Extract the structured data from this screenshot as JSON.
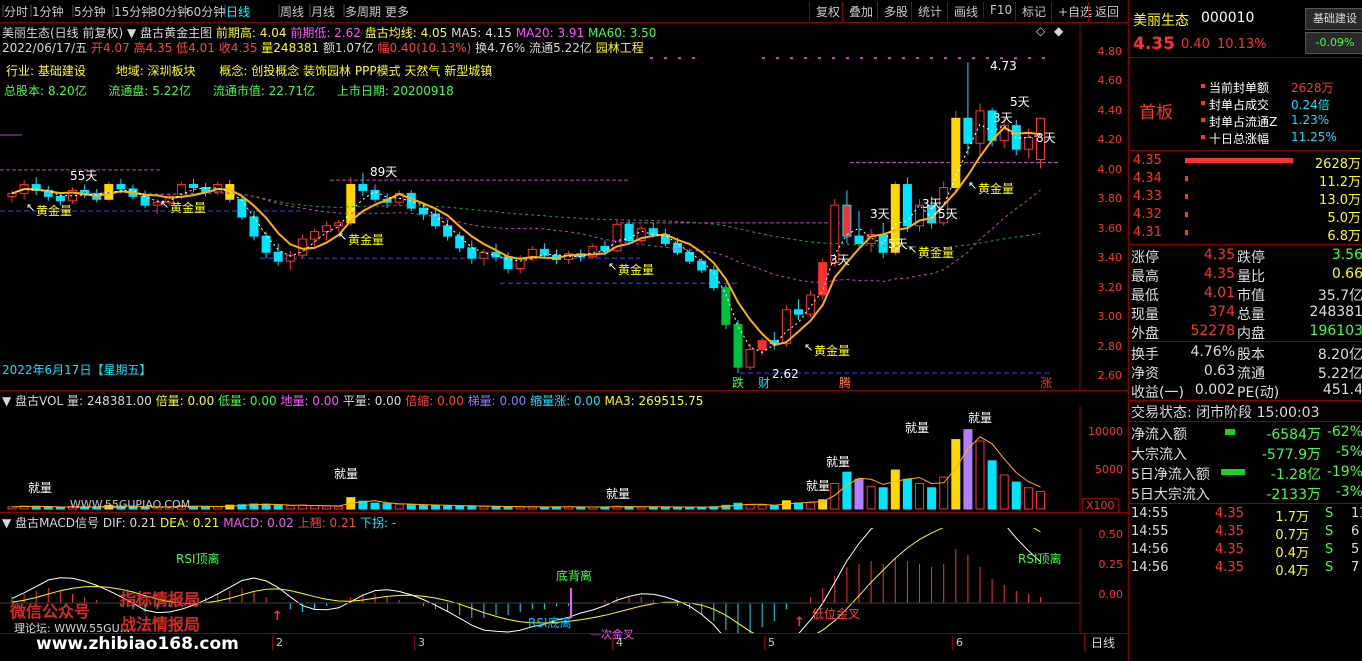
{
  "toolbar": {
    "periods": [
      "分时",
      "1分钟",
      "5分钟",
      "15分钟",
      "30分钟",
      "60分钟",
      "日线",
      "周线",
      "月线",
      "多周期",
      "更多"
    ],
    "active_period": "日线",
    "right_buttons": [
      "复权",
      "叠加",
      "多股",
      "统计",
      "画线",
      "F10",
      "标记",
      "+自选",
      "返回"
    ]
  },
  "header": {
    "line1": {
      "name": "美丽生态(日线 前复权)",
      "indicator": "盘古黄金主图",
      "prev_high_label": "前期高: 4.04",
      "prev_low_label": "前期低: 2.62",
      "pangu_ma_label": "盘古均线: 4.05",
      "ma5": "MA5: 4.15",
      "ma20": "MA20: 3.91",
      "ma60": "MA60: 3.50"
    },
    "line2": {
      "date": "2022/06/17/五",
      "open": "开4.07",
      "high": "高4.35",
      "low": "低4.01",
      "close": "收4.35",
      "volume": "量248381",
      "amount": "额1.07亿",
      "change": "幅0.40(10.13%)",
      "turnover": "换4.76%",
      "float_cap": "流通5.22亿",
      "theme": "园林工程"
    },
    "info1": {
      "industry": "行业: 基础建设",
      "region": "地域: 深圳板块",
      "concept": "概念: 创投概念 装饰园林 PPP模式 天然气 新型城镇"
    },
    "info2": {
      "total_shares": "总股本: 8.20亿",
      "float_shares": "流通盘: 5.22亿",
      "float_mv": "流通市值: 22.71亿",
      "list_date": "上市日期: 20200918"
    }
  },
  "main_chart": {
    "y_ticks": [
      "4.80",
      "4.60",
      "4.40",
      "4.20",
      "4.00",
      "3.80",
      "3.60",
      "3.40",
      "3.20",
      "3.00",
      "2.80",
      "2.60"
    ],
    "annotations": {
      "high": "4.73",
      "low": "2.62",
      "d55": "55天",
      "d89": "89天",
      "d5a": "5天",
      "d3a": "3天",
      "d8": "8天",
      "golden": "黄金量",
      "date_overlay": "2022年6月17日【星期五】",
      "tag_die": "跌",
      "tag_cai": "财",
      "tag_teng": "腾",
      "tag_zhang": "涨"
    },
    "candles": [
      [
        3.82,
        3.86,
        3.78,
        3.84
      ],
      [
        3.84,
        3.93,
        3.8,
        3.9
      ],
      [
        3.9,
        3.95,
        3.83,
        3.86
      ],
      [
        3.86,
        3.89,
        3.79,
        3.82
      ],
      [
        3.82,
        3.85,
        3.76,
        3.79
      ],
      [
        3.79,
        3.88,
        3.77,
        3.86
      ],
      [
        3.86,
        3.9,
        3.81,
        3.84
      ],
      [
        3.84,
        3.87,
        3.78,
        3.8
      ],
      [
        3.8,
        3.92,
        3.79,
        3.9
      ],
      [
        3.9,
        3.94,
        3.84,
        3.87
      ],
      [
        3.87,
        3.9,
        3.8,
        3.82
      ],
      [
        3.82,
        3.86,
        3.74,
        3.76
      ],
      [
        3.76,
        3.8,
        3.7,
        3.78
      ],
      [
        3.78,
        3.84,
        3.76,
        3.82
      ],
      [
        3.82,
        3.92,
        3.8,
        3.9
      ],
      [
        3.9,
        3.94,
        3.85,
        3.88
      ],
      [
        3.88,
        3.91,
        3.82,
        3.85
      ],
      [
        3.85,
        3.92,
        3.83,
        3.9
      ],
      [
        3.9,
        3.93,
        3.78,
        3.8
      ],
      [
        3.8,
        3.82,
        3.66,
        3.68
      ],
      [
        3.68,
        3.72,
        3.52,
        3.55
      ],
      [
        3.55,
        3.58,
        3.4,
        3.44
      ],
      [
        3.44,
        3.5,
        3.35,
        3.38
      ],
      [
        3.38,
        3.45,
        3.32,
        3.42
      ],
      [
        3.42,
        3.56,
        3.4,
        3.53
      ],
      [
        3.53,
        3.6,
        3.48,
        3.58
      ],
      [
        3.58,
        3.65,
        3.52,
        3.62
      ],
      [
        3.62,
        3.66,
        3.58,
        3.64
      ],
      [
        3.64,
        3.95,
        3.62,
        3.9
      ],
      [
        3.9,
        3.98,
        3.82,
        3.86
      ],
      [
        3.86,
        3.9,
        3.78,
        3.8
      ],
      [
        3.8,
        3.84,
        3.74,
        3.78
      ],
      [
        3.78,
        3.86,
        3.76,
        3.84
      ],
      [
        3.84,
        3.86,
        3.72,
        3.74
      ],
      [
        3.74,
        3.78,
        3.66,
        3.7
      ],
      [
        3.7,
        3.74,
        3.6,
        3.62
      ],
      [
        3.62,
        3.66,
        3.52,
        3.55
      ],
      [
        3.55,
        3.58,
        3.44,
        3.47
      ],
      [
        3.47,
        3.52,
        3.36,
        3.4
      ],
      [
        3.4,
        3.46,
        3.35,
        3.44
      ],
      [
        3.44,
        3.5,
        3.38,
        3.41
      ],
      [
        3.41,
        3.44,
        3.3,
        3.33
      ],
      [
        3.33,
        3.42,
        3.3,
        3.4
      ],
      [
        3.4,
        3.48,
        3.38,
        3.46
      ],
      [
        3.46,
        3.5,
        3.4,
        3.42
      ],
      [
        3.42,
        3.46,
        3.36,
        3.39
      ],
      [
        3.39,
        3.45,
        3.36,
        3.43
      ],
      [
        3.43,
        3.46,
        3.38,
        3.41
      ],
      [
        3.41,
        3.5,
        3.4,
        3.48
      ],
      [
        3.48,
        3.52,
        3.42,
        3.45
      ],
      [
        3.45,
        3.66,
        3.44,
        3.63
      ],
      [
        3.63,
        3.66,
        3.5,
        3.52
      ],
      [
        3.52,
        3.62,
        3.5,
        3.6
      ],
      [
        3.6,
        3.64,
        3.54,
        3.56
      ],
      [
        3.56,
        3.6,
        3.48,
        3.5
      ],
      [
        3.5,
        3.54,
        3.42,
        3.44
      ],
      [
        3.44,
        3.46,
        3.36,
        3.38
      ],
      [
        3.38,
        3.4,
        3.3,
        3.32
      ],
      [
        3.32,
        3.35,
        3.18,
        3.2
      ],
      [
        3.2,
        3.22,
        2.92,
        2.95
      ],
      [
        2.95,
        2.98,
        2.62,
        2.66
      ],
      [
        2.66,
        2.82,
        2.64,
        2.78
      ],
      [
        2.78,
        2.86,
        2.74,
        2.84
      ],
      [
        2.84,
        2.9,
        2.78,
        2.82
      ],
      [
        2.82,
        3.08,
        2.8,
        3.05
      ],
      [
        3.05,
        3.12,
        2.98,
        3.02
      ],
      [
        3.02,
        3.18,
        3.0,
        3.15
      ],
      [
        3.15,
        3.4,
        3.12,
        3.37
      ],
      [
        3.37,
        3.8,
        3.34,
        3.76
      ],
      [
        3.76,
        3.86,
        3.5,
        3.55
      ],
      [
        3.55,
        3.72,
        3.48,
        3.5
      ],
      [
        3.5,
        3.6,
        3.44,
        3.56
      ],
      [
        3.56,
        3.64,
        3.4,
        3.44
      ],
      [
        3.44,
        3.92,
        3.42,
        3.9
      ],
      [
        3.9,
        3.95,
        3.58,
        3.62
      ],
      [
        3.62,
        3.8,
        3.58,
        3.76
      ],
      [
        3.76,
        3.82,
        3.6,
        3.64
      ],
      [
        3.64,
        3.92,
        3.62,
        3.88
      ],
      [
        3.88,
        4.4,
        3.86,
        4.35
      ],
      [
        4.35,
        4.73,
        4.1,
        4.18
      ],
      [
        4.18,
        4.45,
        4.1,
        4.4
      ],
      [
        4.4,
        4.42,
        4.16,
        4.2
      ],
      [
        4.2,
        4.36,
        4.15,
        4.3
      ],
      [
        4.3,
        4.34,
        4.1,
        4.14
      ],
      [
        4.14,
        4.28,
        4.08,
        4.22
      ],
      [
        4.07,
        4.35,
        4.01,
        4.35
      ]
    ]
  },
  "vol_panel": {
    "title": "盘古VOL",
    "vol": "量: 248381.00",
    "bei": "倍量: 0.00",
    "di": "低量: 0.00",
    "diliang": "地量: 0.00",
    "ping": "平量: 0.00",
    "beisuo": "倍缩: 0.00",
    "tiliang": "梯量: 0.00",
    "suozhang": "缩量涨: 0.00",
    "ma3": "MA3: 269515.75",
    "y_ticks": [
      "10000",
      "5000"
    ],
    "unit": "X100",
    "jiuliang": "就量",
    "website": "WWW.55GUPIAO.COM",
    "volumes": [
      300,
      420,
      380,
      260,
      240,
      360,
      300,
      280,
      520,
      400,
      320,
      310,
      260,
      300,
      480,
      380,
      300,
      360,
      540,
      600,
      700,
      680,
      520,
      460,
      560,
      480,
      420,
      380,
      1600,
      1100,
      820,
      760,
      680,
      620,
      560,
      520,
      480,
      440,
      420,
      380,
      360,
      340,
      320,
      300,
      280,
      300,
      320,
      280,
      260,
      300,
      380,
      340,
      300,
      280,
      300,
      280,
      260,
      260,
      320,
      520,
      820,
      620,
      540,
      460,
      1160,
      860,
      920,
      1300,
      3600,
      5200,
      4200,
      3200,
      3000,
      5500,
      4200,
      3600,
      3000,
      4500,
      9800,
      11200,
      9600,
      6800,
      4800,
      3800,
      3000,
      2483
    ]
  },
  "macd_panel": {
    "title": "盘古MACD信号",
    "dif": "DIF: 0.21",
    "dea": "DEA: 0.21",
    "macd": "MACD: 0.02",
    "up": "上翘: 0.21",
    "down": "下拐: -",
    "y_ticks": [
      "0.50",
      "0.25",
      "0.00"
    ],
    "labels": {
      "rsi_top": "RSI顶离",
      "rsi_top2": "RSI顶离",
      "bottom_div": "底背离",
      "rsi_div": "RSI底离",
      "golden_cross": "一次金叉",
      "low_golden": "低位金叉",
      "watermark1": "微信公众号",
      "watermark2": "指标情报局",
      "watermark3": "战法情报局",
      "site": "www.zhibiao168.com",
      "forum": "理论坛: WWW.55GU...",
      "bottom_day": "日线"
    },
    "macd_values": [
      0.02,
      0.03,
      0.04,
      0.05,
      0.04,
      0.03,
      0.02,
      0.01,
      0.0,
      -0.01,
      -0.02,
      -0.03,
      -0.02,
      -0.01,
      0.0,
      0.01,
      0.02,
      0.03,
      0.04,
      0.05,
      0.04,
      0.02,
      0.0,
      -0.02,
      -0.03,
      -0.02,
      -0.01,
      0.0,
      0.02,
      0.03,
      0.03,
      0.02,
      0.01,
      0.0,
      -0.01,
      -0.02,
      -0.03,
      -0.04,
      -0.05,
      -0.05,
      -0.04,
      -0.04,
      -0.03,
      -0.02,
      -0.02,
      -0.01,
      -0.01,
      0.0,
      0.0,
      0.01,
      0.02,
      0.02,
      0.02,
      0.01,
      0.0,
      -0.01,
      -0.02,
      -0.04,
      -0.06,
      -0.09,
      -0.12,
      -0.1,
      -0.08,
      -0.06,
      -0.02,
      0.0,
      0.02,
      0.05,
      0.09,
      0.12,
      0.13,
      0.14,
      0.13,
      0.15,
      0.14,
      0.13,
      0.12,
      0.13,
      0.18,
      0.16,
      0.12,
      0.08,
      0.06,
      0.04,
      0.03,
      0.02
    ]
  },
  "right_panel": {
    "name": "美丽生态",
    "code": "000010",
    "btn_fund": "基础建设",
    "btn_pct": "-0.09%",
    "price": "4.35",
    "change": "0.40",
    "pct": "10.13%",
    "first_board": "首板",
    "seal_items": [
      {
        "label": "当前封单额",
        "value": "2628万"
      },
      {
        "label": "封单占成交",
        "value": "0.24倍"
      },
      {
        "label": "封单占流通Z",
        "value": "1.23%"
      },
      {
        "label": "十日总涨幅",
        "value": "11.25%"
      }
    ],
    "order_book": [
      {
        "price": "4.35",
        "vol": "2628万"
      },
      {
        "price": "4.34",
        "vol": "11.2万"
      },
      {
        "price": "4.33",
        "vol": "13.0万"
      },
      {
        "price": "4.32",
        "vol": "5.0万"
      },
      {
        "price": "4.31",
        "vol": "6.8万"
      }
    ],
    "stats": [
      {
        "l1": "涨停",
        "v1": "4.35",
        "l2": "跌停",
        "v2": "3.56"
      },
      {
        "l1": "最高",
        "v1": "4.35",
        "l2": "量比",
        "v2": "0.66"
      },
      {
        "l1": "最低",
        "v1": "4.01",
        "l2": "市值",
        "v2": "35.7亿"
      },
      {
        "l1": "现量",
        "v1": "374",
        "l2": "总量",
        "v2": "248381"
      },
      {
        "l1": "外盘",
        "v1": "52278",
        "l2": "内盘",
        "v2": "196103"
      }
    ],
    "stats2": [
      {
        "l1": "换手",
        "v1": "4.76%",
        "l2": "股本",
        "v2": "8.20亿"
      },
      {
        "l1": "净资",
        "v1": "0.63",
        "l2": "流通",
        "v2": "5.22亿"
      },
      {
        "l1": "收益(一)",
        "v1": "0.002",
        "l2": "PE(动)",
        "v2": "451.4"
      }
    ],
    "trade_status": "交易状态: 闭市阶段 15:00:03",
    "flows": [
      {
        "label": "净流入额",
        "value": "-6584万",
        "pct": "-62%"
      },
      {
        "label": "大宗流入",
        "value": "-577.9万",
        "pct": "-5%"
      },
      {
        "label": "5日净流入额",
        "value": "-1.28亿",
        "pct": "-19%"
      },
      {
        "label": "5日大宗流入",
        "value": "-2133万",
        "pct": "-3%"
      }
    ],
    "ticks": [
      {
        "time": "14:55",
        "price": "4.35",
        "vol": "1.7万",
        "side": "S",
        "n": "11"
      },
      {
        "time": "14:55",
        "price": "4.35",
        "vol": "0.7万",
        "side": "S",
        "n": "6"
      },
      {
        "time": "14:56",
        "price": "4.35",
        "vol": "0.4万",
        "side": "S",
        "n": "5"
      },
      {
        "time": "14:56",
        "price": "4.35",
        "vol": "0.4万",
        "side": "S",
        "n": "7"
      }
    ]
  }
}
